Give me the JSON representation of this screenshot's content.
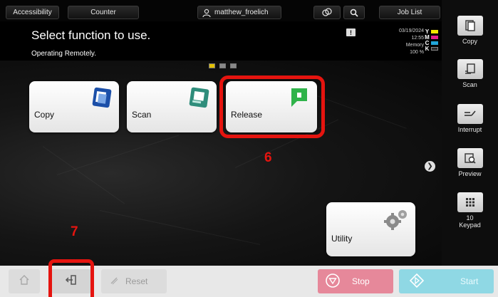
{
  "topbar": {
    "accessibility_label": "Accessibility",
    "counter_label": "Counter",
    "user_name": "matthew_froelich",
    "job_list_label": "Job List"
  },
  "header": {
    "title": "Select function to use.",
    "subtitle": "Operating Remotely.",
    "date": "03/19/2024",
    "time": "12:55",
    "memory_label": "Memory",
    "memory_value": "100 %",
    "toner": [
      {
        "letter": "Y",
        "color": "#f2e600"
      },
      {
        "letter": "M",
        "color": "#e0208c"
      },
      {
        "letter": "C",
        "color": "#21a6d9"
      },
      {
        "letter": "K",
        "color": "#2a2a2a"
      }
    ]
  },
  "tiles": {
    "copy": {
      "label": "Copy",
      "icon": "copy-icon"
    },
    "scan": {
      "label": "Scan",
      "icon": "scan-icon"
    },
    "release": {
      "label": "Release",
      "icon": "release-icon"
    },
    "utility": {
      "label": "Utility",
      "icon": "gears-icon"
    }
  },
  "annotations": {
    "release_number": "6",
    "logout_number": "7",
    "color": "#e5140f"
  },
  "right_panel": {
    "copy_label": "Copy",
    "scan_label": "Scan",
    "interrupt_label": "Interrupt",
    "preview_label": "Preview",
    "keypad_count": "10",
    "keypad_label": "Keypad"
  },
  "bottom": {
    "reset_label": "Reset",
    "stop_label": "Stop",
    "start_label": "Start",
    "stop_color": "#e6889a",
    "start_color": "#8fd8e4"
  }
}
